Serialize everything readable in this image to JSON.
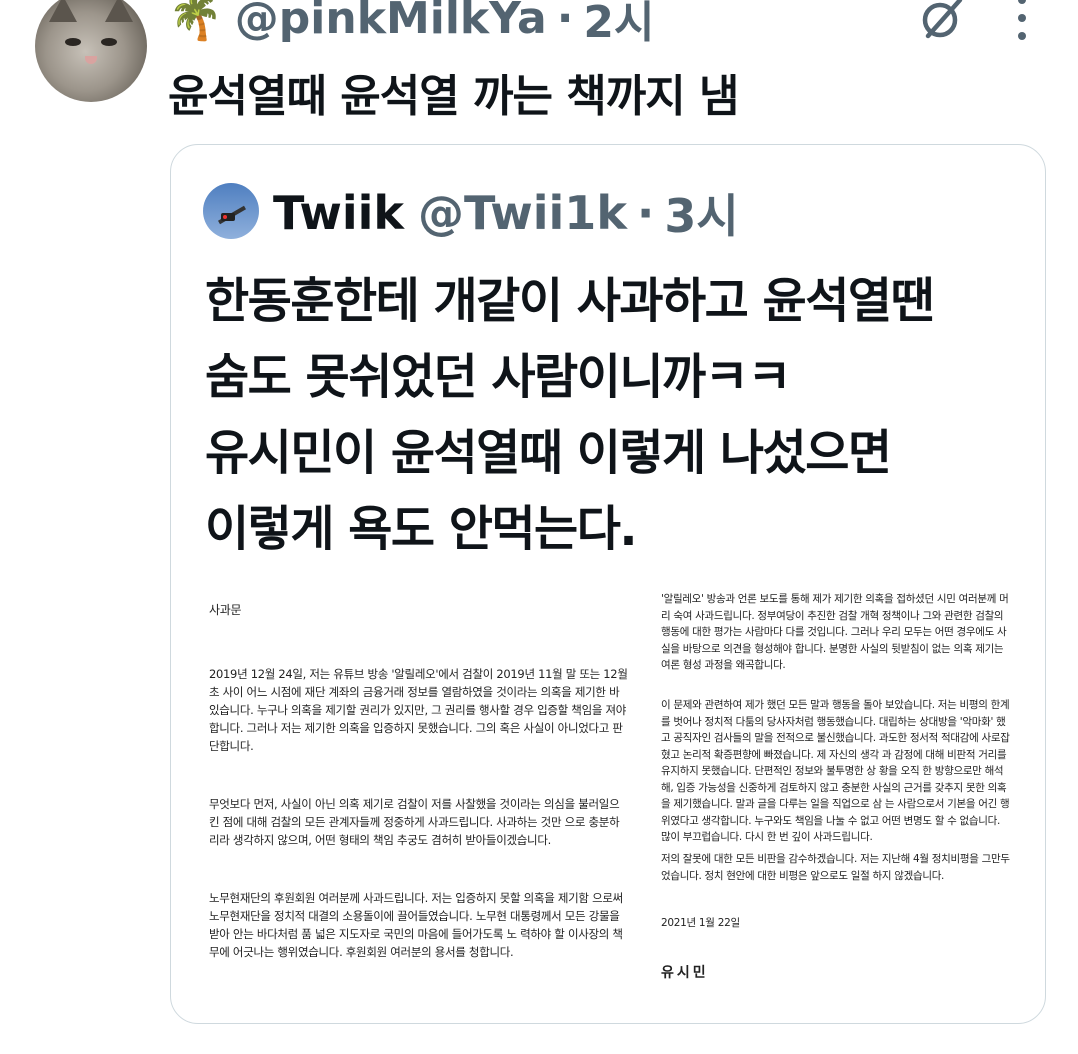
{
  "tweet": {
    "emoji": "🌴",
    "handle": "@pinkMilkYa",
    "separator": "·",
    "time": "2시",
    "text": "윤석열때 윤석열 까는 책까지 냄"
  },
  "icons": {
    "avatar": "cat-avatar",
    "grok": "grok-icon",
    "more": "more-icon"
  },
  "quote": {
    "name": "Twiik",
    "handle": "@Twii1k",
    "separator": "·",
    "time": "3시",
    "lines": [
      "한동훈한테 개같이 사과하고 윤석열땐",
      "숨도 못쉬었던 사람이니까ㅋㅋ",
      "유시민이 윤석열때 이렇게 나섰으면",
      "이렇게 욕도 안먹는다."
    ]
  },
  "document": {
    "title": "사과문",
    "left_paragraphs": [
      "2019년 12월 24일, 저는 유튜브 방송 '알릴레오'에서 검찰이 2019년 11월 말 또는 12월 초 사이 어느 시점에 재단 계좌의 금융거래 정보를 열람하였을 것이라는 의혹을 제기한 바 있습니다. 누구나 의혹을 제기할 권리가 있지만, 그 권리를 행사할 경우 입증할 책임을 져야합니다. 그러나 저는 제기한 의혹을 입증하지 못했습니다. 그의 혹은 사실이 아니었다고 판단합니다.",
      "무엇보다 먼저, 사실이 아닌 의혹 제기로 검찰이 저를 사찰했을 것이라는 의심을 불러일으킨 점에 대해 검찰의 모든 관계자들께 정중하게 사과드립니다. 사과하는 것만 으로 충분하리라 생각하지 않으며, 어떤 형태의 책임 추궁도 겸허히 받아들이겠습니다.",
      "노무현재단의 후원회원 여러분께 사과드립니다. 저는 입증하지 못할 의혹을 제기함 으로써 노무현재단을 정치적 대결의 소용돌이에 끌어들였습니다. 노무현 대통령께서 모든 강물을 받아 안는 바다처럼 품 넓은 지도자로 국민의 마음에 들어가도록 노 력하야 할 이사장의 책무에 어긋나는 행위였습니다. 후원회원 여러분의 용서를 청합니다."
    ],
    "right_paragraphs": [
      "'알릴레오' 방송과 언론 보도를 통해 제가 제기한 의혹을 접하셨던 시민 여러분께 머리 숙여 사과드립니다. 정부여당이 추진한 검찰 개혁 정책이나 그와 관련한 검찰의 행동에 대한 평가는 사람마다 다를 것입니다. 그러나 우리 모두는 어떤 경우에도 사 실을 바탕으로 의견을 형성해야 합니다. 분명한 사실의 뒷받침이 없는 의혹 제기는 여론 형성 과정을 왜곡합니다.",
      "이 문제와 관련하여 제가 했던 모든 말과 행동을 돌아 보았습니다. 저는 비평의 한계를 벗어나 정치적 다툼의 당사자처럼 행동했습니다. 대립하는 상대방을 '악마화' 했고 공직자인 검사들의 말을 전적으로 불신했습니다. 과도한 정서적 적대감에 사로잡혔고 논리적 확증편향에 빠졌습니다. 제 자신의 생각 과 감정에 대해 비판적 거리를 유지하지 못했습니다. 단편적인 정보와 불투명한 상 황을 오직 한 방향으로만 해석해, 입증 가능성을 신중하게 검토하지 않고 충분한 사실의 근거를 갖추지 못한 의혹을 제기했습니다. 말과 글을 다루는 일을 직업으로 삼 는 사람으로서 기본을 어긴 행위였다고 생각합니다. 누구와도 책임을 나눌 수 없고 어떤 변명도 할 수 없습니다. 많이 부끄럽습니다. 다시 한 번 깊이 사과드립니다.",
      "저의 잘못에 대한 모든 비판을 감수하겠습니다. 저는 지난해 4월 정치비평을 그만두었습니다. 정치 현안에 대한 비평은 앞으로도 일절 하지 않겠습니다."
    ],
    "date": "2021년 1월 22일",
    "signature": "유시민"
  }
}
